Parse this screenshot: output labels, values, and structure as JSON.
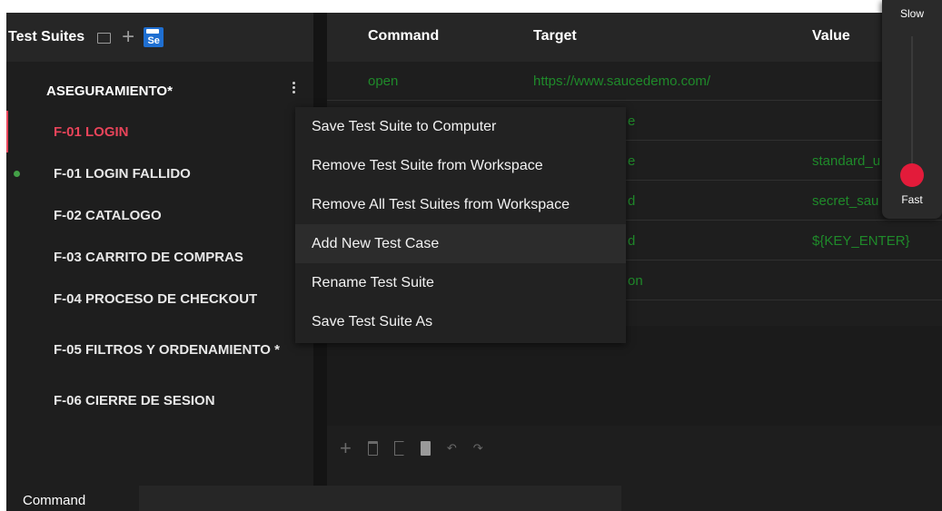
{
  "sidebar": {
    "title": "Test Suites",
    "icons": [
      "folder-icon",
      "plus-icon",
      "selenium-logo-icon"
    ],
    "se_logo_text": "Se",
    "suite": {
      "name": "ASEGURAMIENTO*"
    },
    "cases": [
      {
        "label": "F-01 LOGIN",
        "active": true
      },
      {
        "label": "F-01 LOGIN FALLIDO",
        "status": "passed"
      },
      {
        "label": "F-02 CATALOGO"
      },
      {
        "label": "F-03 CARRITO DE COMPRAS"
      },
      {
        "label": "F-04 PROCESO DE CHECKOUT"
      },
      {
        "label": "F-05 FILTROS Y ORDENAMIENTO *"
      },
      {
        "label": "F-06 CIERRE DE SESION"
      }
    ]
  },
  "table": {
    "headers": {
      "command": "Command",
      "target": "Target",
      "value": "Value"
    },
    "rows": [
      {
        "command": "open",
        "target": "https://www.saucedemo.com/",
        "value": ""
      },
      {
        "command": "",
        "target": "e",
        "value": ""
      },
      {
        "command": "",
        "target": "e",
        "value": "standard_u"
      },
      {
        "command": "",
        "target": "d",
        "value": "secret_sau"
      },
      {
        "command": "",
        "target": "d",
        "value": "${KEY_ENTER}"
      },
      {
        "command": "",
        "target": "on",
        "value": ""
      }
    ]
  },
  "context_menu": {
    "items": [
      "Save Test Suite to Computer",
      "Remove Test Suite from Workspace",
      "Remove All Test Suites from Workspace",
      "Add New Test Case",
      "Rename Test Suite",
      "Save Test Suite As"
    ],
    "hovered_index": 3
  },
  "toolbar": {
    "icons": [
      "add-icon",
      "trash-icon",
      "copy-icon",
      "paste-icon",
      "undo-icon",
      "redo-icon"
    ]
  },
  "editor": {
    "command_label": "Command",
    "command_value": ""
  },
  "speed": {
    "slow_label": "Slow",
    "fast_label": "Fast",
    "level": 1.0
  },
  "colors": {
    "accent": "#e8445a",
    "command_text": "#1f8a2a",
    "status_pass": "#43a047",
    "speed_knob": "#e31b3a"
  }
}
